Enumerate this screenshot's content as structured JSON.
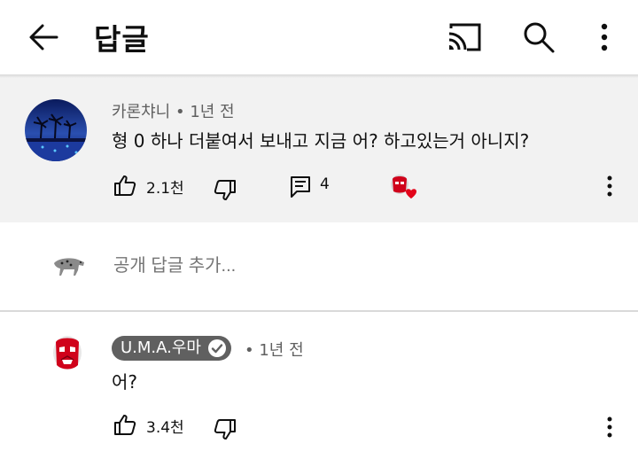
{
  "header": {
    "title": "답글"
  },
  "parent_comment": {
    "author": "카론챠니",
    "time": "1년 전",
    "text": "형 0 하나 더붙여서 보내고 지금 어? 하고있는거 아니지?",
    "likes": "2.1천",
    "replies": "4"
  },
  "reply_input": {
    "placeholder": "공개 답글 추가..."
  },
  "reply": {
    "author": "U.M.A.우마",
    "time": "1년 전",
    "text": "어?",
    "likes": "3.4천"
  },
  "colors": {
    "highlight_bg": "#f2f2f2",
    "creator_heart": "#e3051b",
    "badge_bg": "#606060"
  }
}
